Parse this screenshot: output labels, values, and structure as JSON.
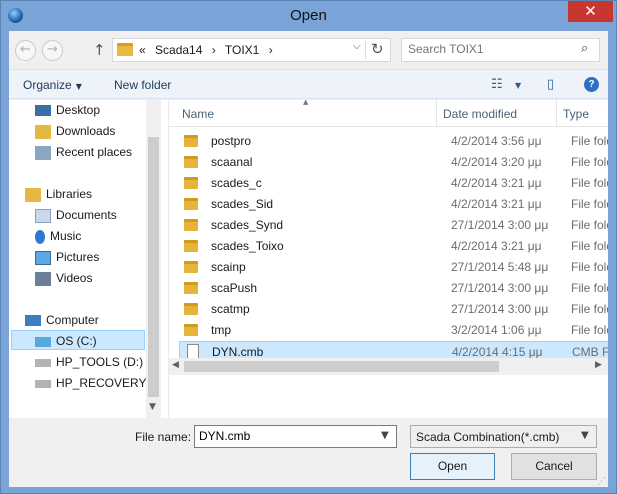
{
  "window": {
    "title": "Open",
    "close_glyph": "✕"
  },
  "nav_buttons": {
    "back": "←",
    "forward": "→",
    "up": "↑"
  },
  "address": {
    "crumbs": [
      "«",
      "Scada14",
      "›",
      "TOIX1",
      "›"
    ],
    "dropdown": "⌵",
    "refresh": "↻"
  },
  "search": {
    "placeholder": "Search TOIX1",
    "icon": "⌕"
  },
  "toolbar": {
    "organize": "Organize",
    "new_folder": "New folder",
    "arrow": "▼",
    "views_icon": "☷",
    "preview_icon": "▯",
    "help_icon": "?"
  },
  "sidebar": {
    "items": [
      {
        "label": "Desktop",
        "icon": "desktop-icon",
        "color": "#3a6ea5"
      },
      {
        "label": "Downloads",
        "icon": "downloads-icon",
        "color": "#e4b842"
      },
      {
        "label": "Recent places",
        "icon": "recent-places-icon",
        "color": "#6a8fb6"
      },
      {
        "label": "Libraries",
        "icon": "libraries-icon",
        "color": "#e4b842"
      },
      {
        "label": "Documents",
        "icon": "documents-icon",
        "color": "#9bb7d4"
      },
      {
        "label": "Music",
        "icon": "music-icon",
        "color": "#2f7ad1"
      },
      {
        "label": "Pictures",
        "icon": "pictures-icon",
        "color": "#5aa9e6"
      },
      {
        "label": "Videos",
        "icon": "videos-icon",
        "color": "#6b7f96"
      },
      {
        "label": "Computer",
        "icon": "computer-icon",
        "color": "#3f7cc2"
      },
      {
        "label": "OS (C:)",
        "icon": "drive-icon",
        "color": "#58a8e0"
      },
      {
        "label": "HP_TOOLS (D:)",
        "icon": "drive-icon",
        "color": "#9a9a9a"
      },
      {
        "label": "HP_RECOVERY (F",
        "icon": "drive-icon",
        "color": "#9a9a9a"
      }
    ],
    "scroll_down": "▼"
  },
  "columns": {
    "name": "Name",
    "date": "Date modified",
    "type": "Type",
    "sort_caret": "▲"
  },
  "files": [
    {
      "name": "postpro",
      "date": "4/2/2014 3:56 μμ",
      "type": "File folder",
      "kind": "folder"
    },
    {
      "name": "scaanal",
      "date": "4/2/2014 3:20 μμ",
      "type": "File folder",
      "kind": "folder"
    },
    {
      "name": "scades_c",
      "date": "4/2/2014 3:21 μμ",
      "type": "File folder",
      "kind": "folder"
    },
    {
      "name": "scades_Sid",
      "date": "4/2/2014 3:21 μμ",
      "type": "File folder",
      "kind": "folder"
    },
    {
      "name": "scades_Synd",
      "date": "27/1/2014 3:00 μμ",
      "type": "File folder",
      "kind": "folder"
    },
    {
      "name": "scades_Toixo",
      "date": "4/2/2014 3:21 μμ",
      "type": "File folder",
      "kind": "folder"
    },
    {
      "name": "scainp",
      "date": "27/1/2014 5:48 μμ",
      "type": "File folder",
      "kind": "folder"
    },
    {
      "name": "scaPush",
      "date": "27/1/2014 3:00 μμ",
      "type": "File folder",
      "kind": "folder"
    },
    {
      "name": "scatmp",
      "date": "27/1/2014 3:00 μμ",
      "type": "File folder",
      "kind": "folder"
    },
    {
      "name": "tmp",
      "date": "3/2/2014 1:06 μμ",
      "type": "File folder",
      "kind": "folder"
    },
    {
      "name": "DYN.cmb",
      "date": "4/2/2014 4:15 μμ",
      "type": "CMB File",
      "kind": "file"
    }
  ],
  "hscroll": {
    "left": "◀",
    "right": "▶"
  },
  "bottom": {
    "file_name_label": "File name:",
    "file_name_value": "DYN.cmb",
    "file_name_dropdown": "▼",
    "file_type": "Scada Combination(*.cmb)",
    "file_type_dropdown": "▼",
    "open_label": "Open",
    "cancel_label": "Cancel",
    "grip": "⋰"
  }
}
